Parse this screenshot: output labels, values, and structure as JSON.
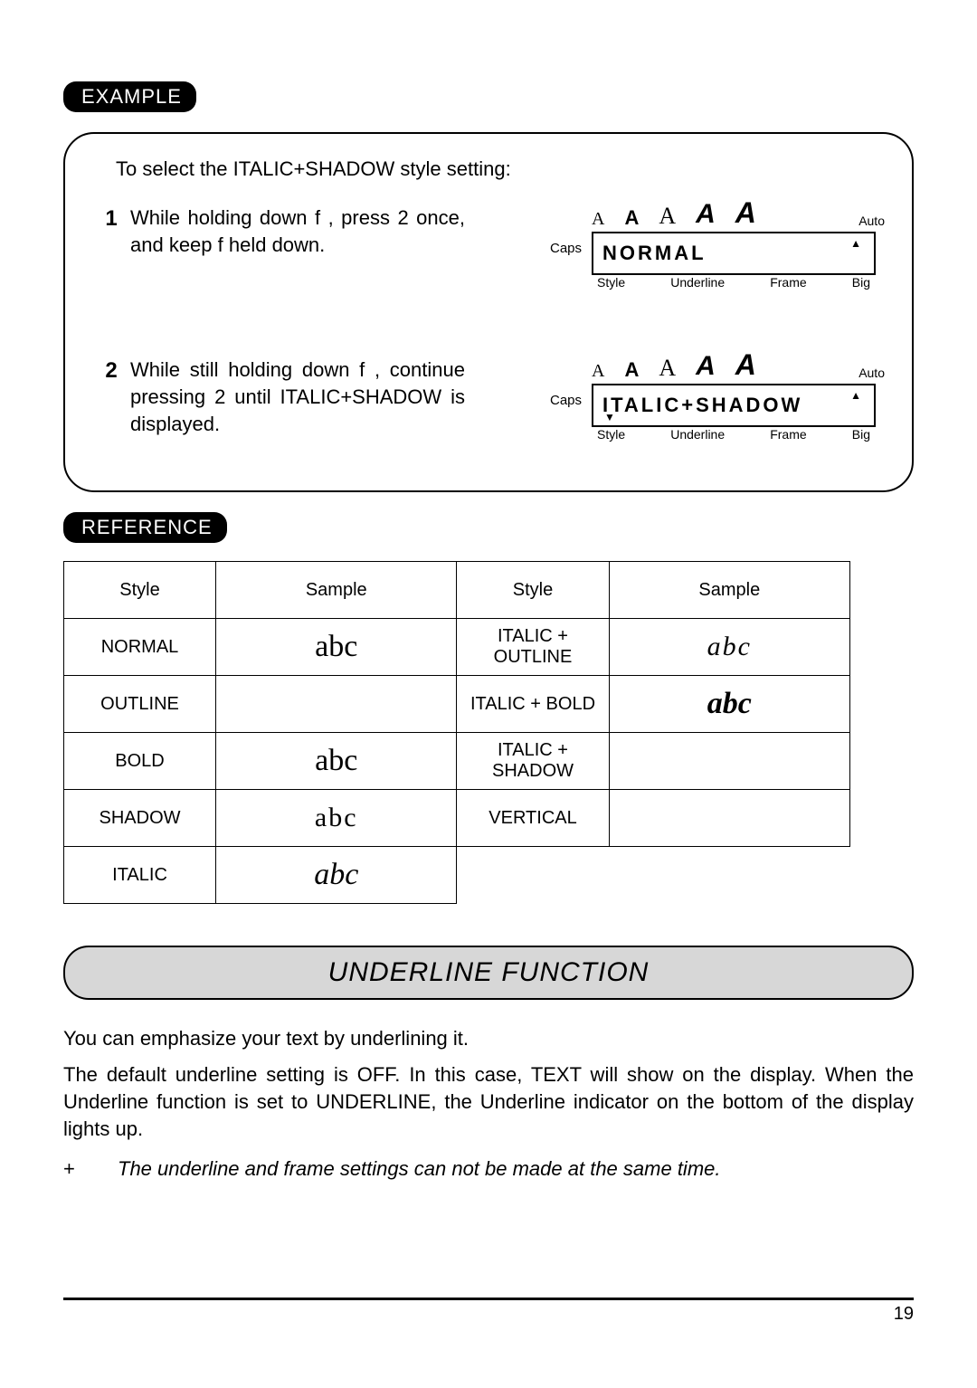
{
  "labels": {
    "example": "EXAMPLE",
    "reference": "REFERENCE"
  },
  "example": {
    "intro": "To select the ITALIC+SHADOW style setting:",
    "steps": [
      {
        "num": "1",
        "text": "While holding down  f , press 2 once, and keep f  held down."
      },
      {
        "num": "2",
        "text": "While still holding down  f , continue pressing 2  until ITALIC+SHADOW is displayed."
      }
    ],
    "lcd_common": {
      "caps": "Caps",
      "auto": "Auto",
      "bottom": {
        "style": "Style",
        "underline": "Underline",
        "frame": "Frame",
        "big": "Big"
      },
      "icons": {
        "a1": "A",
        "a2": "A",
        "a3": "A",
        "a4": "A",
        "a5": "A"
      }
    },
    "lcd1": {
      "display": "NORMAL"
    },
    "lcd2": {
      "display": "ITALIC+SHADOW"
    }
  },
  "reference": {
    "headers": {
      "style": "Style",
      "sample": "Sample"
    },
    "left_rows": [
      {
        "style": "NORMAL",
        "sample": "abc"
      },
      {
        "style": "OUTLINE",
        "sample": ""
      },
      {
        "style": "BOLD",
        "sample": "abc"
      },
      {
        "style": "SHADOW",
        "sample": "abc"
      },
      {
        "style": "ITALIC",
        "sample": "abc"
      }
    ],
    "right_rows": [
      {
        "style": "ITALIC + OUTLINE",
        "sample": "abc"
      },
      {
        "style": "ITALIC + BOLD",
        "sample": "abc"
      },
      {
        "style": "ITALIC + SHADOW",
        "sample": ""
      },
      {
        "style": "VERTICAL",
        "sample": ""
      }
    ]
  },
  "section_title": "UNDERLINE FUNCTION",
  "underline": {
    "p1": "You can emphasize your text by underlining it.",
    "p2": "The default underline setting is OFF. In this case,  TEXT  will show on the display. When the Underline function is set to UNDERLINE, the Underline indicator on the bottom of the display lights up.",
    "note_symbol": "+",
    "note": "The underline and frame settings can not be made at the same time."
  },
  "page_number": "19"
}
